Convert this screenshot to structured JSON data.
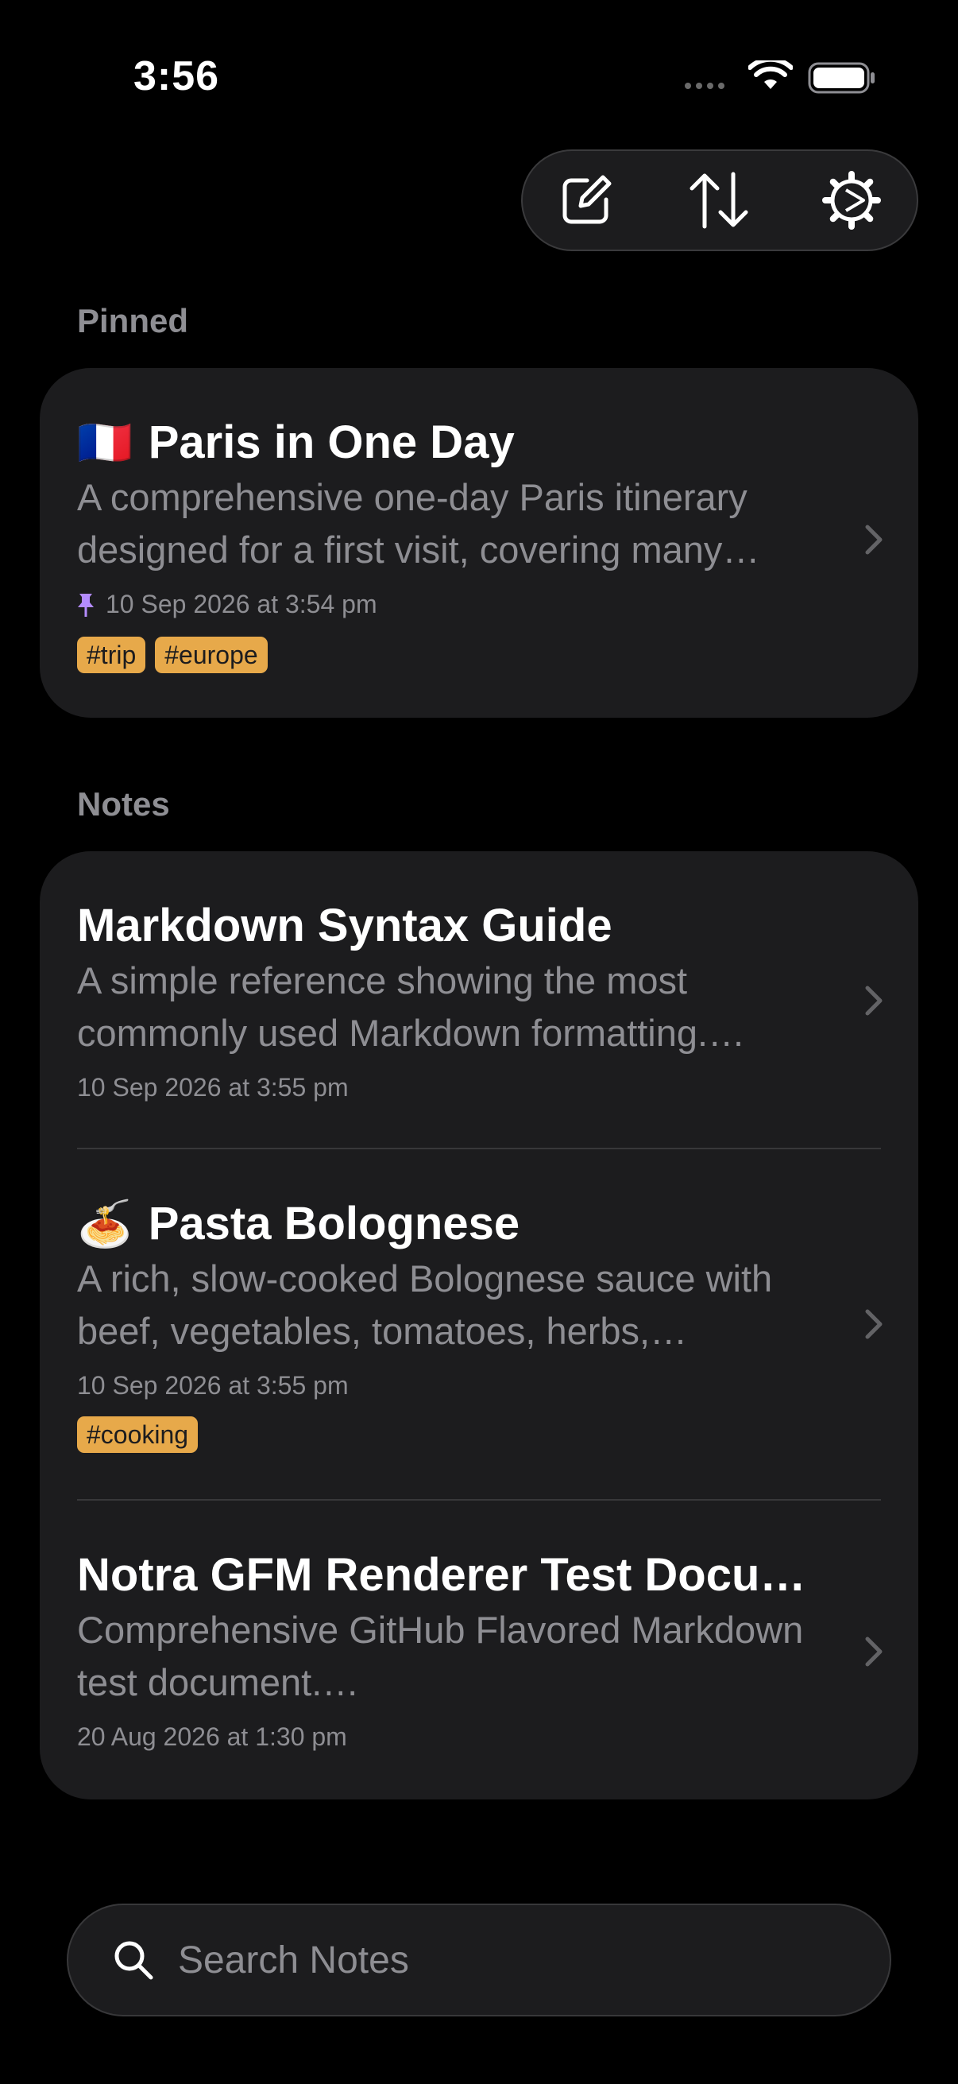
{
  "status_bar": {
    "time": "3:56"
  },
  "toolbar": {
    "new_note_icon": "square-and-pencil-icon",
    "sort_icon": "arrow-up-down-icon",
    "settings_icon": "gear-icon"
  },
  "sections": {
    "pinned": {
      "header": "Pinned",
      "notes": [
        {
          "emoji": "🇫🇷",
          "title": "Paris in One Day",
          "snippet": "A comprehensive one-day Paris itinerary designed for a first visit, covering many…",
          "date": "10 Sep 2026 at 3:54 pm",
          "pinned": true,
          "tags": [
            "#trip",
            "#europe"
          ]
        }
      ]
    },
    "notes": {
      "header": "Notes",
      "notes": [
        {
          "emoji": "",
          "title": "Markdown Syntax Guide",
          "snippet": "A simple reference showing the most commonly used Markdown formatting.…",
          "date": "10 Sep 2026 at 3:55 pm",
          "tags": []
        },
        {
          "emoji": "🍝",
          "title": "Pasta Bolognese",
          "snippet": "A rich, slow-cooked Bolognese sauce with beef, vegetables, tomatoes, herbs,…",
          "date": "10 Sep 2026 at 3:55 pm",
          "tags": [
            "#cooking"
          ]
        },
        {
          "emoji": "",
          "title": "Notra GFM Renderer Test Docu…",
          "snippet": "Comprehensive GitHub Flavored Markdown test document.…",
          "date": "20 Aug 2026 at 1:30 pm",
          "tags": []
        }
      ]
    }
  },
  "search": {
    "placeholder": "Search Notes"
  },
  "colors": {
    "tag_background": "#e7a94a",
    "pin_color": "#b48cff",
    "card": "#1c1c1e"
  }
}
